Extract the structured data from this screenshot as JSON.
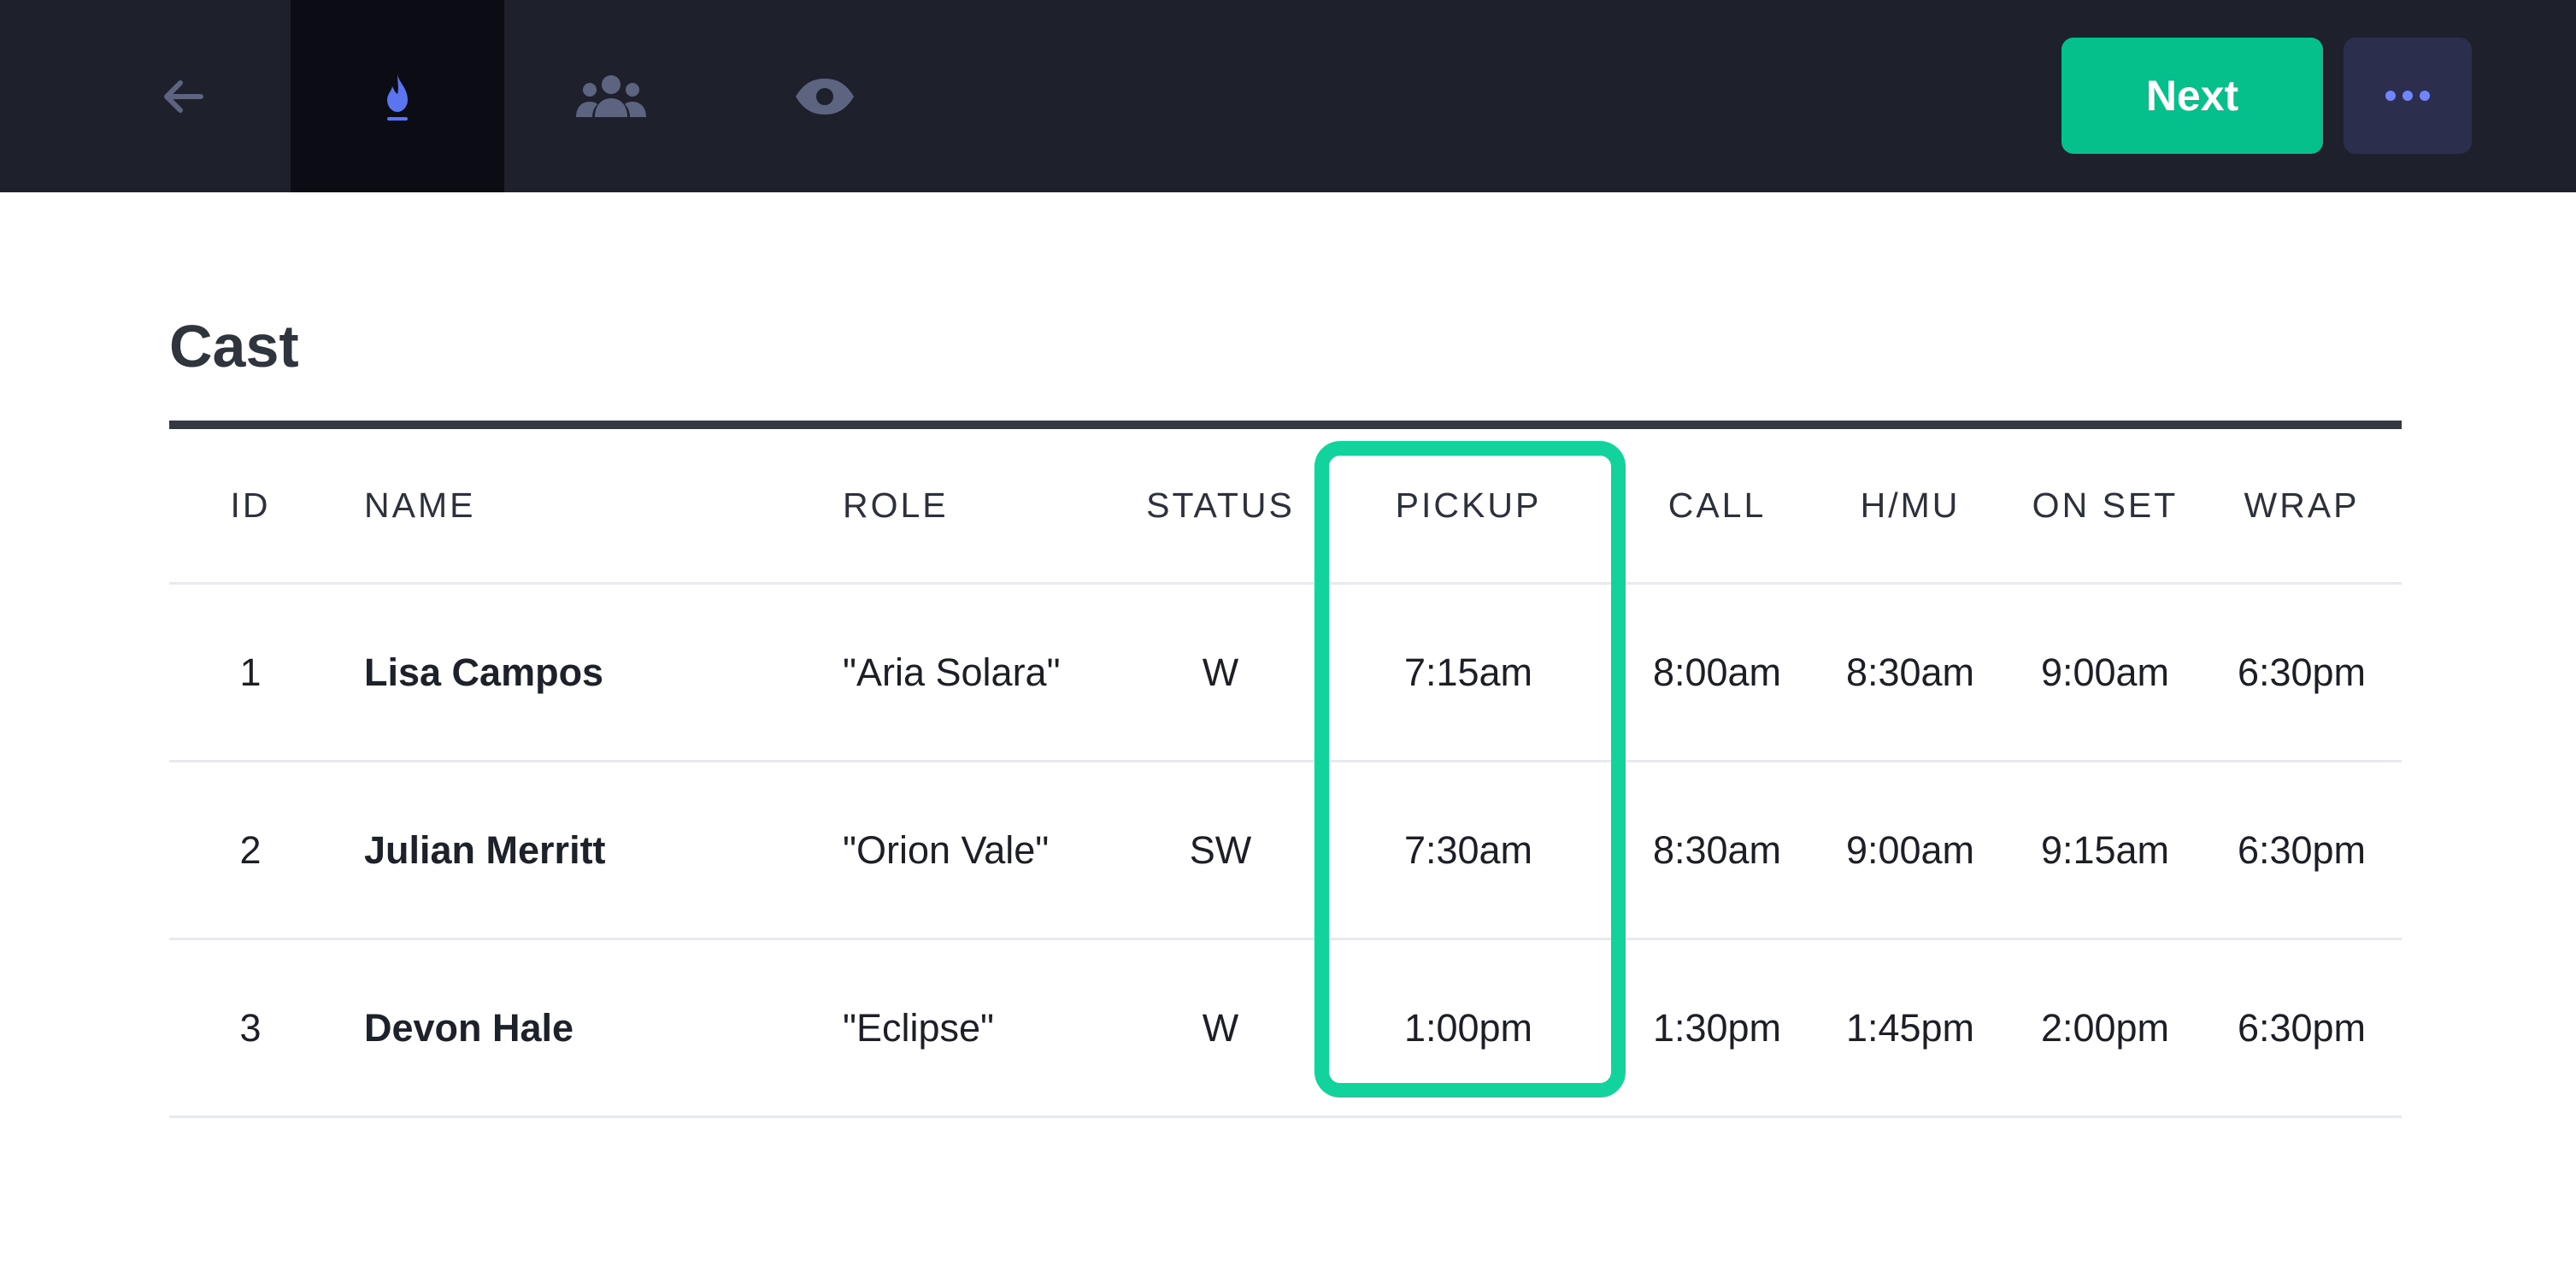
{
  "nav": {
    "tabs": [
      {
        "icon": "arrow-left-icon",
        "active": false
      },
      {
        "icon": "flame-icon",
        "active": true
      },
      {
        "icon": "people-icon",
        "active": false
      },
      {
        "icon": "eye-icon",
        "active": false
      }
    ],
    "next_label": "Next",
    "more_icon": "ellipsis-icon",
    "colors": {
      "bar": "#1e202c",
      "active_tab": "#0c0d14",
      "accent": "#05c08a",
      "flame": "#5b74f0",
      "muted_icon": "#5d6480"
    }
  },
  "section": {
    "title": "Cast"
  },
  "table": {
    "headers": {
      "id": "ID",
      "name": "NAME",
      "role": "ROLE",
      "status": "STATUS",
      "pickup": "PICKUP",
      "call": "CALL",
      "hmu": "H/MU",
      "onset": "ON SET",
      "wrap": "WRAP"
    },
    "rows": [
      {
        "id": "1",
        "name": "Lisa Campos",
        "role": "\"Aria Solara\"",
        "status": "W",
        "pickup": "7:15am",
        "call": "8:00am",
        "hmu": "8:30am",
        "onset": "9:00am",
        "wrap": "6:30pm"
      },
      {
        "id": "2",
        "name": "Julian Merritt",
        "role": "\"Orion Vale\"",
        "status": "SW",
        "pickup": "7:30am",
        "call": "8:30am",
        "hmu": "9:00am",
        "onset": "9:15am",
        "wrap": "6:30pm"
      },
      {
        "id": "3",
        "name": "Devon Hale",
        "role": "\"Eclipse\"",
        "status": "W",
        "pickup": "1:00pm",
        "call": "1:30pm",
        "hmu": "1:45pm",
        "onset": "2:00pm",
        "wrap": "6:30pm"
      }
    ],
    "highlight_color": "#12d39b"
  }
}
